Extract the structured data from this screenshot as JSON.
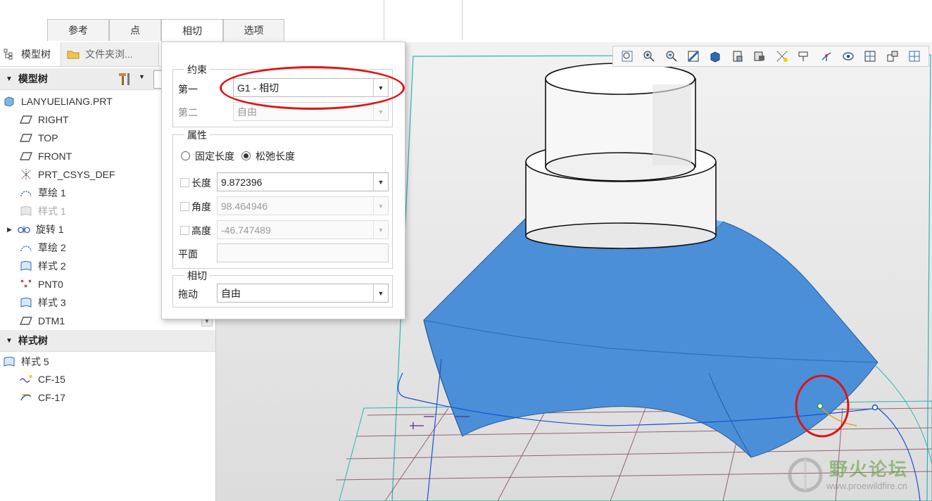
{
  "ribbon": {
    "tabs": [
      "参考",
      "点",
      "相切",
      "选项"
    ],
    "active_tab": "相切"
  },
  "left_panel": {
    "tabs": [
      "模型树",
      "文件夹浏..."
    ],
    "model_tree": {
      "header": "模型树",
      "items": [
        {
          "label": "LANYUELIANG.PRT",
          "icon": "part-icon"
        },
        {
          "label": "RIGHT",
          "icon": "datum-plane-icon"
        },
        {
          "label": "TOP",
          "icon": "datum-plane-icon"
        },
        {
          "label": "FRONT",
          "icon": "datum-plane-icon"
        },
        {
          "label": "PRT_CSYS_DEF",
          "icon": "csys-icon"
        },
        {
          "label": "草绘 1",
          "icon": "sketch-icon"
        },
        {
          "label": "样式 1",
          "icon": "style-icon"
        },
        {
          "label": "旋转 1",
          "icon": "revolve-icon"
        },
        {
          "label": "草绘 2",
          "icon": "sketch-icon"
        },
        {
          "label": "样式 2",
          "icon": "style-icon"
        },
        {
          "label": "PNT0",
          "icon": "datum-point-icon"
        },
        {
          "label": "样式 3",
          "icon": "style-icon"
        },
        {
          "label": "DTM1",
          "icon": "datum-plane-icon"
        }
      ]
    },
    "style_tree": {
      "header": "样式树",
      "items": [
        {
          "label": "样式 5",
          "icon": "style-icon"
        },
        {
          "label": "CF-15",
          "icon": "curve-icon"
        },
        {
          "label": "CF-17",
          "icon": "curve-icon"
        }
      ]
    }
  },
  "dialog": {
    "constraint": {
      "title": "约束",
      "first_label": "第一",
      "first_value": "G1 - 相切",
      "second_label": "第二",
      "second_value": "自由"
    },
    "properties": {
      "title": "属性",
      "radio_fixed": "固定长度",
      "radio_relaxed": "松弛长度",
      "length_label": "长度",
      "length_value": "9.872396",
      "angle_label": "角度",
      "angle_value": "98.464946",
      "height_label": "高度",
      "height_value": "-46.747489",
      "plane_label": "平面",
      "plane_value": ""
    },
    "tangent": {
      "title": "相切",
      "drag_label": "拖动",
      "drag_value": "自由"
    }
  },
  "viewport": {
    "toolbar_icons": [
      "refit-icon",
      "zoom-in-icon",
      "zoom-out-icon",
      "repaint-icon",
      "display-style-icon",
      "saved-views-icon",
      "view-manager-icon",
      "datum-display-icon",
      "annotation-display-icon",
      "spin-center-icon",
      "appearance-icon",
      "section-icon",
      "orient-icon",
      "layout-icon"
    ],
    "watermark_title": "野火论坛",
    "watermark_url": "www.proewildfire.cn"
  },
  "colors": {
    "surface_blue": "#4a8fd8",
    "highlight_red": "#e01313",
    "datum_cyan": "#2bb4b4",
    "grid_maroon": "#7a3b4a"
  }
}
